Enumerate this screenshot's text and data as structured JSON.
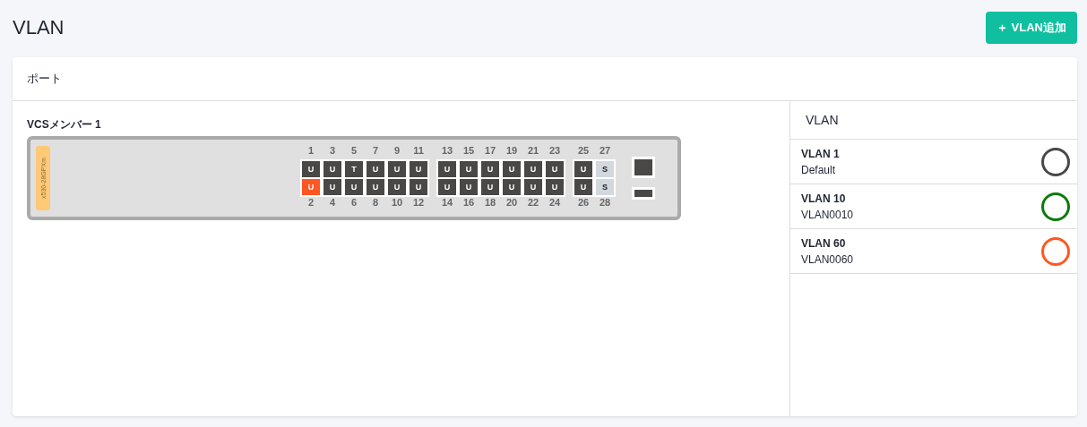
{
  "page": {
    "title": "VLAN",
    "add_button": "＋ VLAN追加"
  },
  "ports_card": {
    "title": "ポート",
    "member": "VCSメンバー 1",
    "model": "x530-28GPXm",
    "port_groups": [
      {
        "columns": [
          {
            "top": {
              "number": "1",
              "mode": "U",
              "color": "#4a4846"
            },
            "bottom": {
              "number": "2",
              "mode": "U",
              "color": "#ff5722"
            }
          },
          {
            "top": {
              "number": "3",
              "mode": "U",
              "color": "#4a4846"
            },
            "bottom": {
              "number": "4",
              "mode": "U",
              "color": "#4a4846"
            }
          },
          {
            "top": {
              "number": "5",
              "mode": "T",
              "color": "#4a4846"
            },
            "bottom": {
              "number": "6",
              "mode": "U",
              "color": "#4a4846"
            }
          },
          {
            "top": {
              "number": "7",
              "mode": "U",
              "color": "#4a4846"
            },
            "bottom": {
              "number": "8",
              "mode": "U",
              "color": "#4a4846"
            }
          },
          {
            "top": {
              "number": "9",
              "mode": "U",
              "color": "#4a4846"
            },
            "bottom": {
              "number": "10",
              "mode": "U",
              "color": "#4a4846"
            }
          },
          {
            "top": {
              "number": "11",
              "mode": "U",
              "color": "#4a4846"
            },
            "bottom": {
              "number": "12",
              "mode": "U",
              "color": "#4a4846"
            }
          }
        ]
      },
      {
        "columns": [
          {
            "top": {
              "number": "13",
              "mode": "U",
              "color": "#4a4846"
            },
            "bottom": {
              "number": "14",
              "mode": "U",
              "color": "#4a4846"
            }
          },
          {
            "top": {
              "number": "15",
              "mode": "U",
              "color": "#4a4846"
            },
            "bottom": {
              "number": "16",
              "mode": "U",
              "color": "#4a4846"
            }
          },
          {
            "top": {
              "number": "17",
              "mode": "U",
              "color": "#4a4846"
            },
            "bottom": {
              "number": "18",
              "mode": "U",
              "color": "#4a4846"
            }
          },
          {
            "top": {
              "number": "19",
              "mode": "U",
              "color": "#4a4846"
            },
            "bottom": {
              "number": "20",
              "mode": "U",
              "color": "#4a4846"
            }
          },
          {
            "top": {
              "number": "21",
              "mode": "U",
              "color": "#4a4846"
            },
            "bottom": {
              "number": "22",
              "mode": "U",
              "color": "#4a4846"
            }
          },
          {
            "top": {
              "number": "23",
              "mode": "U",
              "color": "#4a4846"
            },
            "bottom": {
              "number": "24",
              "mode": "U",
              "color": "#4a4846"
            }
          }
        ]
      },
      {
        "columns": [
          {
            "top": {
              "number": "25",
              "mode": "U",
              "color": "#4a4846"
            },
            "bottom": {
              "number": "26",
              "mode": "U",
              "color": "#4a4846"
            }
          },
          {
            "top": {
              "number": "27",
              "mode": "S",
              "color": "#d3d7de"
            },
            "bottom": {
              "number": "28",
              "mode": "S",
              "color": "#d3d7de"
            }
          }
        ]
      }
    ]
  },
  "vlan_panel": {
    "title": "VLAN",
    "items": [
      {
        "name": "VLAN 1",
        "description": "Default",
        "color": "#4a4846"
      },
      {
        "name": "VLAN 10",
        "description": "VLAN0010",
        "color": "#0c7a0c"
      },
      {
        "name": "VLAN 60",
        "description": "VLAN0060",
        "color": "#ff5722"
      }
    ]
  }
}
